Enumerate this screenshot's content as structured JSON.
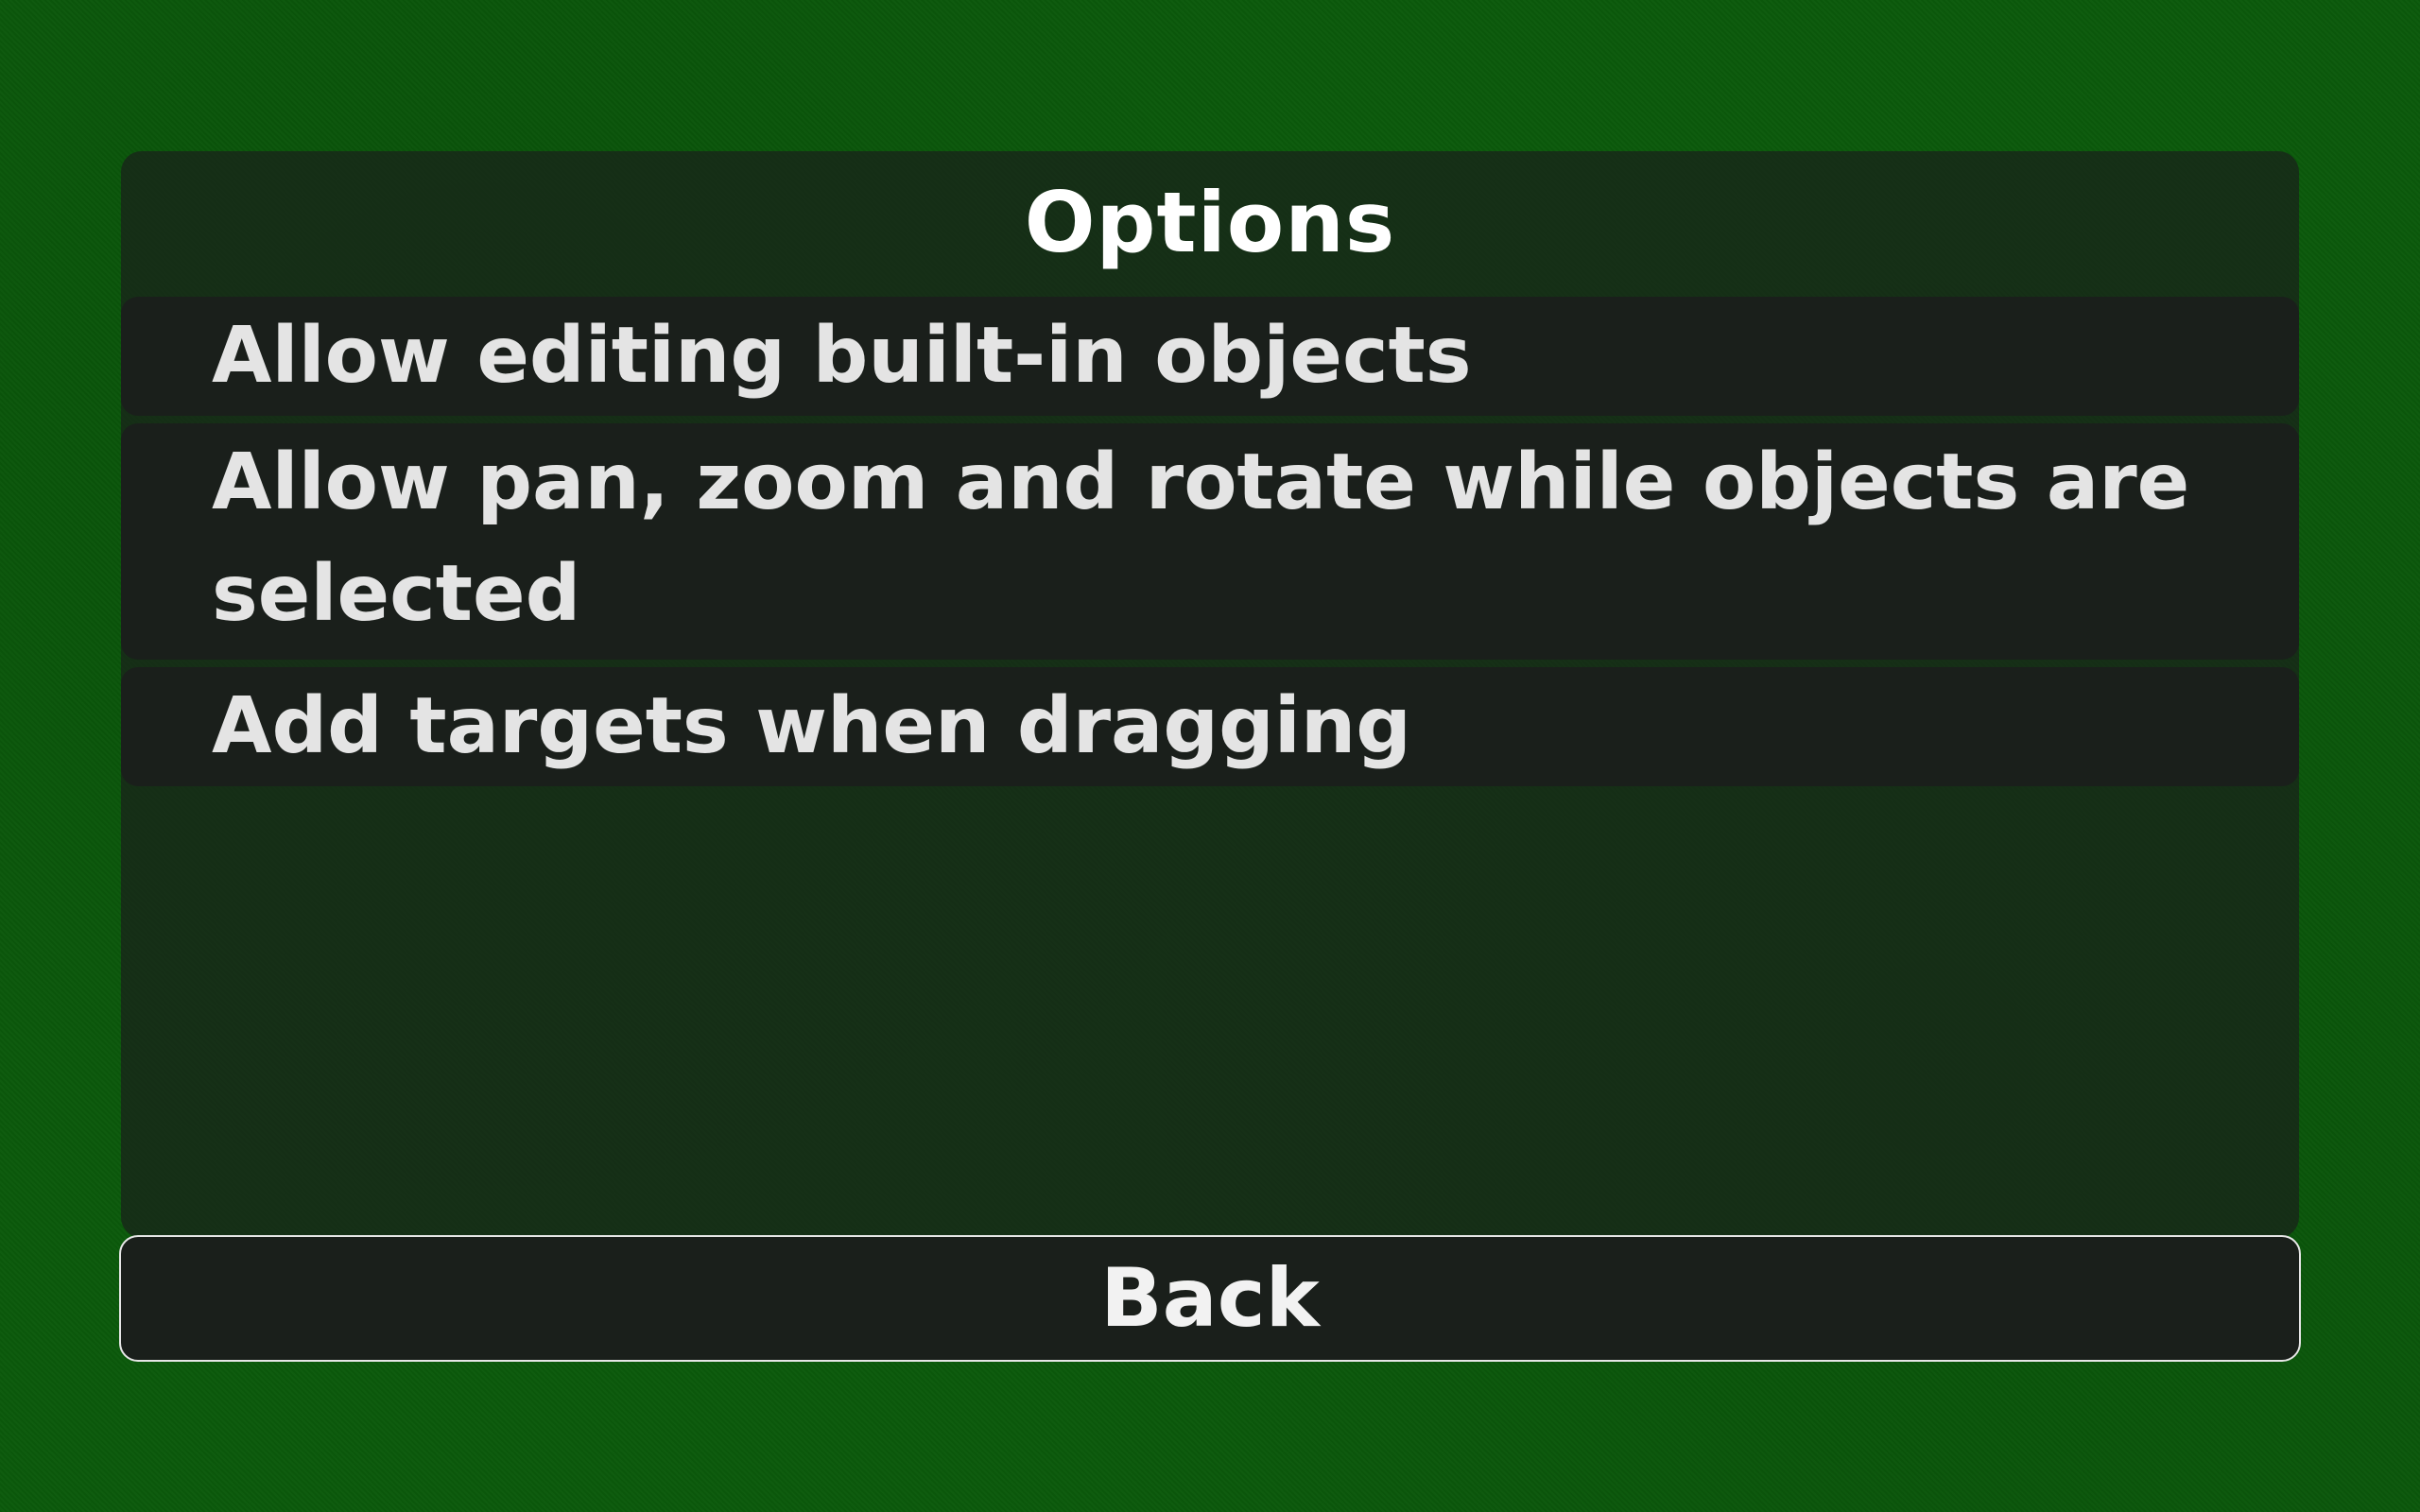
{
  "dialog": {
    "title": "Options",
    "options": [
      {
        "label": "Allow editing built-in objects"
      },
      {
        "label": "Allow pan, zoom and rotate while objects are selected"
      },
      {
        "label": "Add targets when dragging"
      }
    ],
    "back_label": "Back"
  },
  "colors": {
    "background": "#0b5a0b",
    "panel": "#18241a",
    "item": "#1a1f1b",
    "text": "#e4e4e4"
  }
}
